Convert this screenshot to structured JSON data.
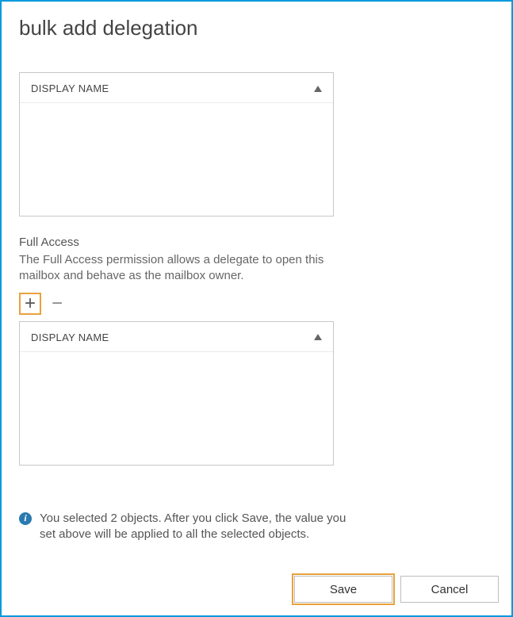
{
  "page": {
    "title": "bulk add delegation"
  },
  "grid1": {
    "header": "DISPLAY NAME"
  },
  "fullAccess": {
    "label": "Full Access",
    "description": "The Full Access permission allows a delegate to open this mailbox and behave as the mailbox owner."
  },
  "grid2": {
    "header": "DISPLAY NAME"
  },
  "info": {
    "text": "You selected 2 objects.  After you click Save, the value you set above will be applied to all the selected objects."
  },
  "buttons": {
    "save": "Save",
    "cancel": "Cancel"
  }
}
